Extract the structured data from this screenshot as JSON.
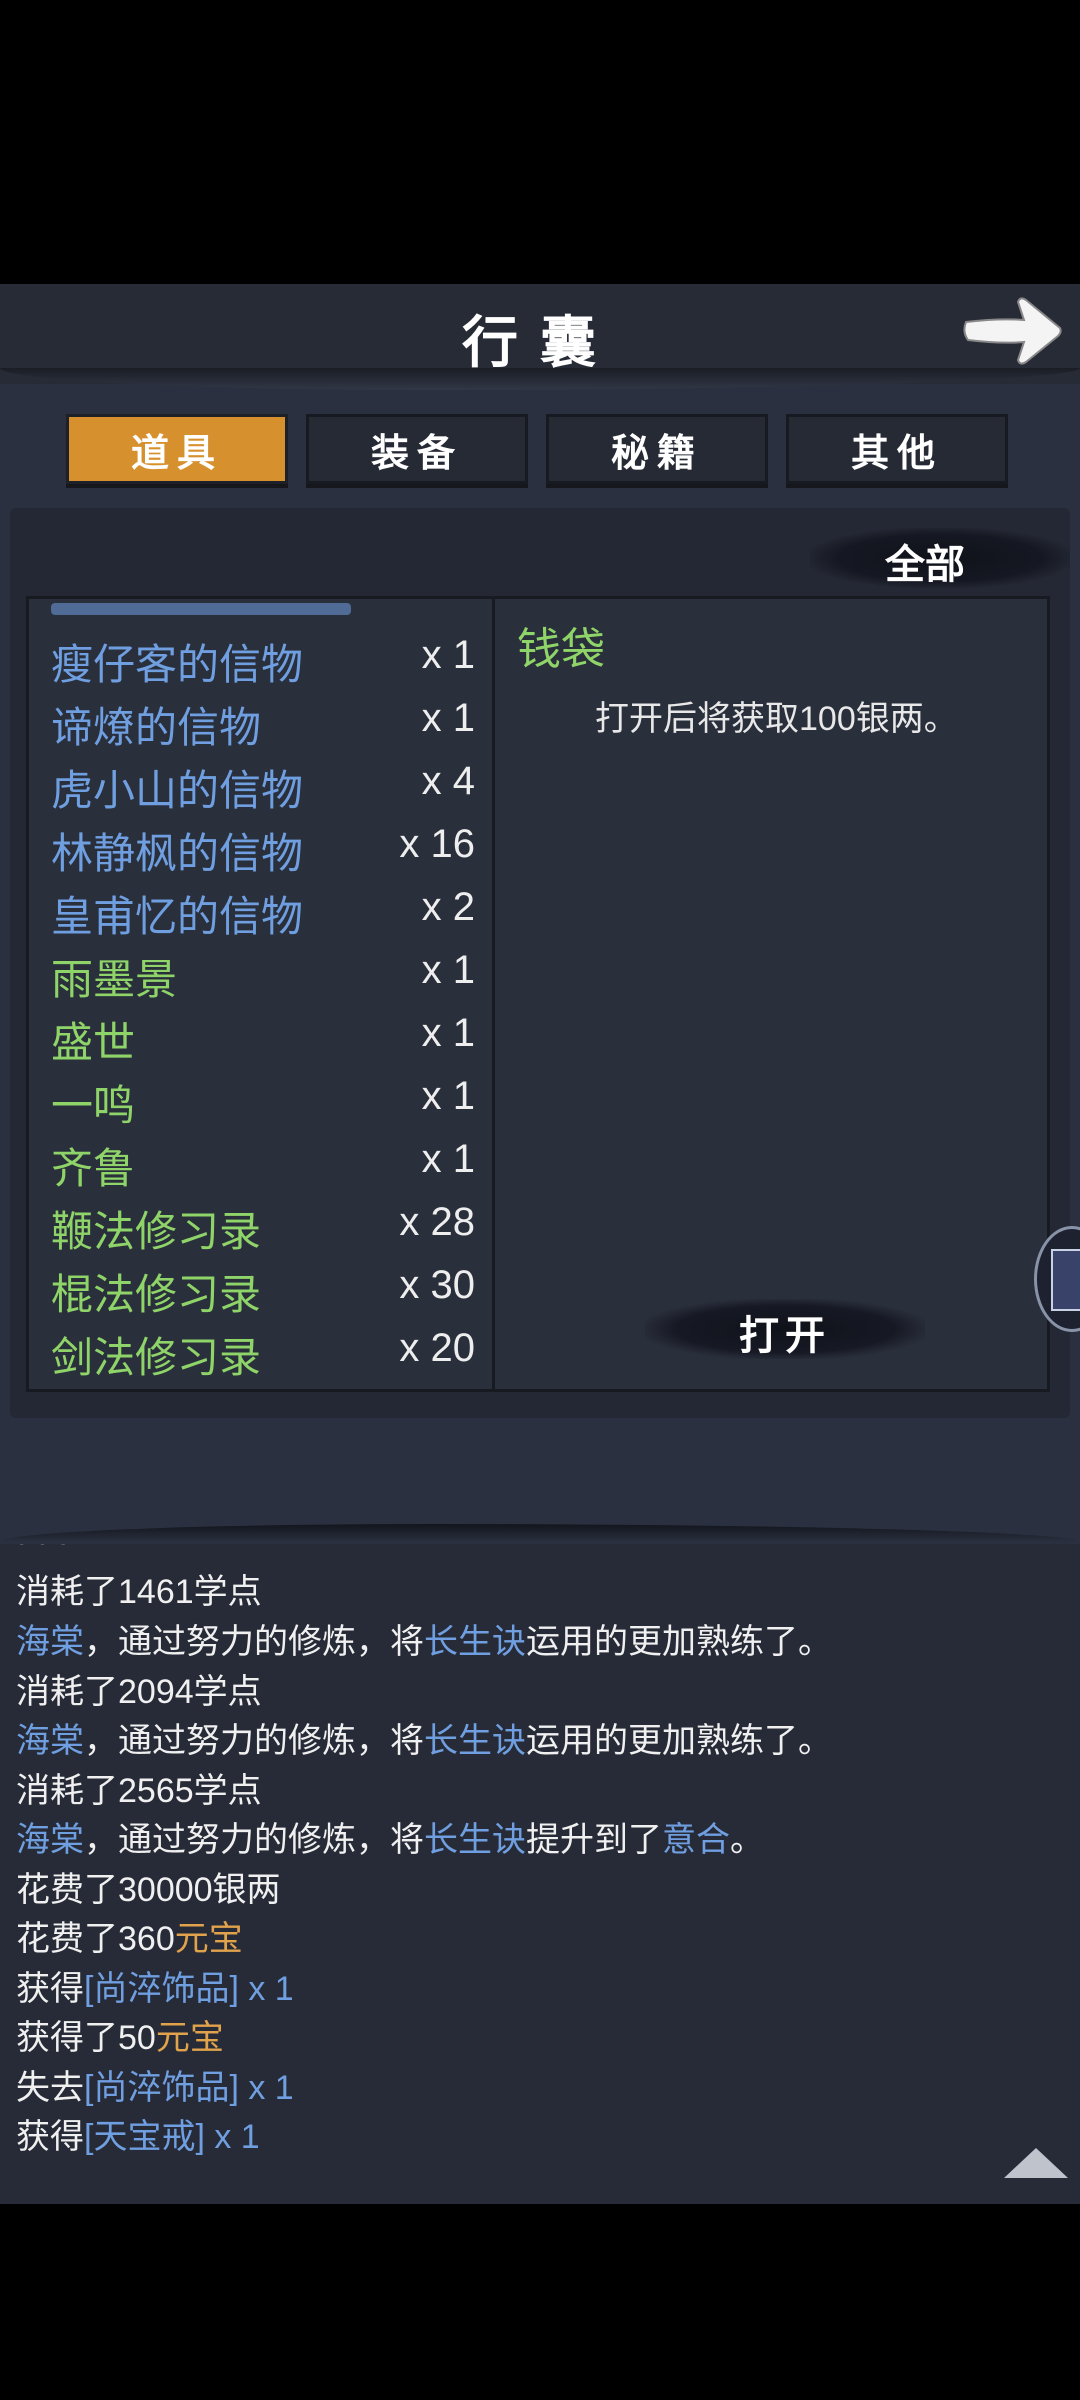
{
  "header": {
    "title": "行囊",
    "back_icon": "arrow-right-icon"
  },
  "tabs": [
    {
      "label": "道具",
      "active": true
    },
    {
      "label": "装备",
      "active": false
    },
    {
      "label": "秘籍",
      "active": false
    },
    {
      "label": "其他",
      "active": false
    }
  ],
  "filter": {
    "label": "全部"
  },
  "items": [
    {
      "name": "瘦仔客的信物",
      "count": "x 1",
      "color": "#6f9fe0"
    },
    {
      "name": "谛燎的信物",
      "count": "x 1",
      "color": "#6f9fe0"
    },
    {
      "name": "虎小山的信物",
      "count": "x 4",
      "color": "#6f9fe0"
    },
    {
      "name": "林静枫的信物",
      "count": "x 16",
      "color": "#6f9fe0"
    },
    {
      "name": "皇甫忆的信物",
      "count": "x 2",
      "color": "#6f9fe0"
    },
    {
      "name": "雨墨景",
      "count": "x 1",
      "color": "#8fd468"
    },
    {
      "name": "盛世",
      "count": "x 1",
      "color": "#8fd468"
    },
    {
      "name": "一鸣",
      "count": "x 1",
      "color": "#8fd468"
    },
    {
      "name": "齐鲁",
      "count": "x 1",
      "color": "#8fd468"
    },
    {
      "name": "鞭法修习录",
      "count": "x 28",
      "color": "#8fd468"
    },
    {
      "name": "棍法修习录",
      "count": "x 30",
      "color": "#8fd468"
    },
    {
      "name": "剑法修习录",
      "count": "x 20",
      "color": "#8fd468"
    }
  ],
  "detail": {
    "name": "钱袋",
    "description": "打开后将获取100银两。",
    "action_label": "打开"
  },
  "log": [
    {
      "parts": [
        {
          "text": "消耗了1461学点",
          "color": "w"
        }
      ]
    },
    {
      "parts": [
        {
          "text": "海棠",
          "color": "b"
        },
        {
          "text": "，通过努力的修炼，将",
          "color": "w"
        },
        {
          "text": "长生诀",
          "color": "b"
        },
        {
          "text": "运用的更加熟练了。",
          "color": "w"
        }
      ]
    },
    {
      "parts": [
        {
          "text": "消耗了2094学点",
          "color": "w"
        }
      ]
    },
    {
      "parts": [
        {
          "text": "海棠",
          "color": "b"
        },
        {
          "text": "，通过努力的修炼，将",
          "color": "w"
        },
        {
          "text": "长生诀",
          "color": "b"
        },
        {
          "text": "运用的更加熟练了。",
          "color": "w"
        }
      ]
    },
    {
      "parts": [
        {
          "text": "消耗了2565学点",
          "color": "w"
        }
      ]
    },
    {
      "parts": [
        {
          "text": "海棠",
          "color": "b"
        },
        {
          "text": "，通过努力的修炼，将",
          "color": "w"
        },
        {
          "text": "长生诀",
          "color": "b"
        },
        {
          "text": "提升到了",
          "color": "w"
        },
        {
          "text": "意合",
          "color": "b"
        },
        {
          "text": "。",
          "color": "w"
        }
      ]
    },
    {
      "parts": [
        {
          "text": "花费了30000银两",
          "color": "w"
        }
      ]
    },
    {
      "parts": [
        {
          "text": "花费了360",
          "color": "w"
        },
        {
          "text": "元宝",
          "color": "o"
        }
      ]
    },
    {
      "parts": [
        {
          "text": "获得",
          "color": "w"
        },
        {
          "text": "[尚淬饰品] x 1",
          "color": "b"
        }
      ]
    },
    {
      "parts": [
        {
          "text": "获得了50",
          "color": "w"
        },
        {
          "text": "元宝",
          "color": "o"
        }
      ]
    },
    {
      "parts": [
        {
          "text": "失去",
          "color": "w"
        },
        {
          "text": "[尚淬饰品] x 1",
          "color": "b"
        }
      ]
    },
    {
      "parts": [
        {
          "text": "获得",
          "color": "w"
        },
        {
          "text": "[天宝戒] x 1",
          "color": "b"
        }
      ]
    }
  ],
  "scroll_icon": "triangle-up-icon"
}
